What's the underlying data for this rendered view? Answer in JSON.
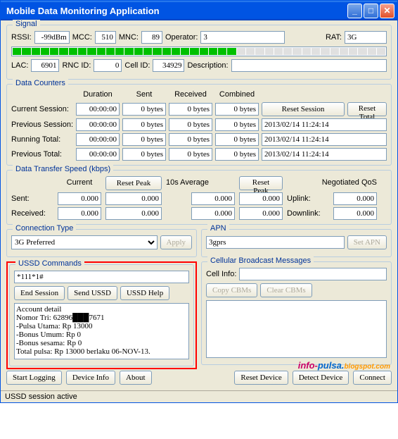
{
  "title": "Mobile Data Monitoring Application",
  "signal": {
    "group": "Signal",
    "rssi_lbl": "RSSI:",
    "rssi": "-99dBm",
    "mcc_lbl": "MCC:",
    "mcc": "510",
    "mnc_lbl": "MNC:",
    "mnc": "89",
    "op_lbl": "Operator:",
    "op": "3",
    "rat_lbl": "RAT:",
    "rat": "3G",
    "lac_lbl": "LAC:",
    "lac": "6901",
    "rnc_lbl": "RNC ID:",
    "rnc": "0",
    "cell_lbl": "Cell ID:",
    "cell": "34929",
    "desc_lbl": "Description:",
    "desc": ""
  },
  "counters": {
    "group": "Data Counters",
    "h_dur": "Duration",
    "h_sent": "Sent",
    "h_recv": "Received",
    "h_comb": "Combined",
    "rows": [
      {
        "lbl": "Current Session:",
        "dur": "00:00:00",
        "sent": "0 bytes",
        "recv": "0 bytes",
        "comb": "0 bytes",
        "btn1": "Reset Session",
        "btn2": "Reset Total"
      },
      {
        "lbl": "Previous Session:",
        "dur": "00:00:00",
        "sent": "0 bytes",
        "recv": "0 bytes",
        "comb": "0 bytes",
        "ts": "2013/02/14 11:24:14"
      },
      {
        "lbl": "Running Total:",
        "dur": "00:00:00",
        "sent": "0 bytes",
        "recv": "0 bytes",
        "comb": "0 bytes",
        "ts": "2013/02/14 11:24:14"
      },
      {
        "lbl": "Previous Total:",
        "dur": "00:00:00",
        "sent": "0 bytes",
        "recv": "0 bytes",
        "comb": "0 bytes",
        "ts": "2013/02/14 11:24:14"
      }
    ]
  },
  "speed": {
    "group": "Data Transfer Speed (kbps)",
    "current": "Current",
    "reset_peak": "Reset Peak",
    "avg": "10s Average",
    "qos": "Negotiated QoS",
    "sent_lbl": "Sent:",
    "recv_lbl": "Received:",
    "uplink_lbl": "Uplink:",
    "downlink_lbl": "Downlink:",
    "vals": {
      "sc": "0.000",
      "sp": "0.000",
      "sa": "0.000",
      "sap": "0.000",
      "rc": "0.000",
      "rp": "0.000",
      "ra": "0.000",
      "rap": "0.000",
      "up": "0.000",
      "dn": "0.000"
    }
  },
  "conn": {
    "group": "Connection Type",
    "sel": "3G Preferred",
    "apply": "Apply"
  },
  "apn": {
    "group": "APN",
    "val": "3gprs",
    "set": "Set APN"
  },
  "ussd": {
    "group": "USSD Commands",
    "input": "*111*1#",
    "end": "End Session",
    "send": "Send USSD",
    "help": "USSD Help",
    "result": "Account detail\nNomor Tri: 62896███7671\n-Pulsa Utama: Rp 13000\n-Bonus Umum: Rp 0\n-Bonus sesama: Rp 0\nTotal pulsa: Rp 13000 berlaku 06-NOV-13."
  },
  "cbm": {
    "group": "Cellular Broadcast Messages",
    "cell_lbl": "Cell Info:",
    "cell": "",
    "copy": "Copy CBMs",
    "clear": "Clear CBMs"
  },
  "bottom": {
    "start": "Start Logging",
    "dev": "Device Info",
    "about": "About",
    "reset": "Reset Device",
    "detect": "Detect Device",
    "conn": "Connect"
  },
  "status": "USSD session active",
  "watermark": {
    "a": "info-",
    "b": "pulsa.",
    "c": "blogspot.com"
  }
}
